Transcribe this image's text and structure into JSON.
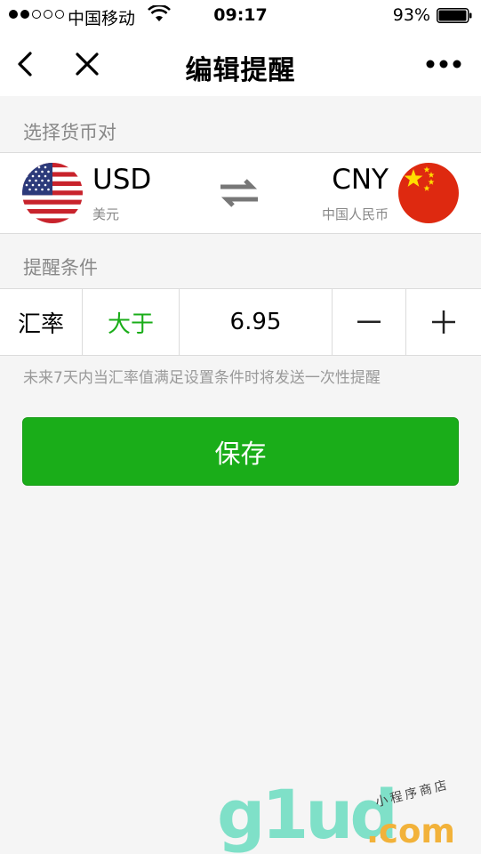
{
  "status_bar": {
    "carrier": "中国移动",
    "time": "09:17",
    "battery": "93%"
  },
  "nav": {
    "title": "编辑提醒"
  },
  "currency": {
    "section_label": "选择货币对",
    "from": {
      "code": "USD",
      "name": "美元"
    },
    "to": {
      "code": "CNY",
      "name": "中国人民币"
    }
  },
  "condition": {
    "section_label": "提醒条件",
    "label": "汇率",
    "operator": "大于",
    "value": "6.95",
    "minus": "−",
    "plus": "+",
    "hint": "未来7天内当汇率值满足设置条件时将发送一次性提醒"
  },
  "save_label": "保存",
  "watermark": {
    "logo": "g1ud",
    "domain": ".com",
    "tagline": "小程序商店"
  },
  "colors": {
    "accent": "#1aad19",
    "background": "#f5f5f5"
  }
}
